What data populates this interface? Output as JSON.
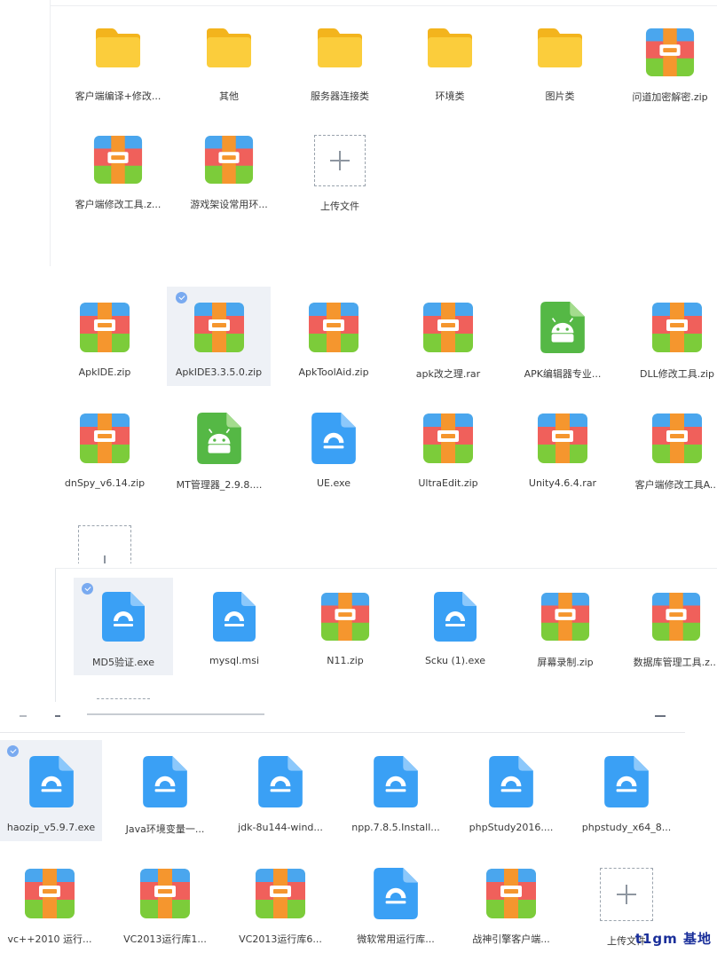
{
  "panel1": {
    "row1": [
      "客户端编译+修改...",
      "其他",
      "服务器连接类",
      "环境类",
      "图片类",
      "问道加密解密.zip"
    ],
    "row2": [
      "客户端修改工具.z...",
      "游戏架设常用环..."
    ],
    "upload_label": "上传文件"
  },
  "panel2": {
    "row1": [
      "ApkIDE.zip",
      "ApkIDE3.3.5.0.zip",
      "ApkToolAid.zip",
      "apk改之理.rar",
      "APK编辑器专业...",
      "DLL修改工具.zip"
    ],
    "row2": [
      "dnSpy_v6.14.zip",
      "MT管理器_2.9.8....",
      "UE.exe",
      "UltraEdit.zip",
      "Unity4.6.4.rar",
      "客户端修改工具A..."
    ]
  },
  "panel3": {
    "row1": [
      "MD5验证.exe",
      "mysql.msi",
      "N11.zip",
      "Scku (1).exe",
      "屏幕录制.zip",
      "数据库管理工具.z..."
    ]
  },
  "panel4": {
    "row1": [
      "haozip_v5.9.7.exe",
      "Java环境变量一...",
      "jdk-8u144-wind...",
      "npp.7.8.5.Install...",
      "phpStudy2016....",
      "phpstudy_x64_8..."
    ],
    "row2": [
      "vc++2010 运行...",
      "VC2013运行库1...",
      "VC2013运行库6...",
      "微软常用运行库...",
      "战神引擎客户端...",
      "上传文件"
    ]
  },
  "watermark": "t1gm 基地",
  "colors": {
    "folder": "#f8c52e",
    "archive_red": "#f0605b",
    "archive_green": "#7ccc3a",
    "archive_blue": "#4aa6ee",
    "archive_strap": "#f5962e",
    "exe_blue": "#3aa0f5",
    "android_green": "#55b845",
    "selection_bg": "#eef1f6",
    "check_blue": "#79aaf0"
  }
}
